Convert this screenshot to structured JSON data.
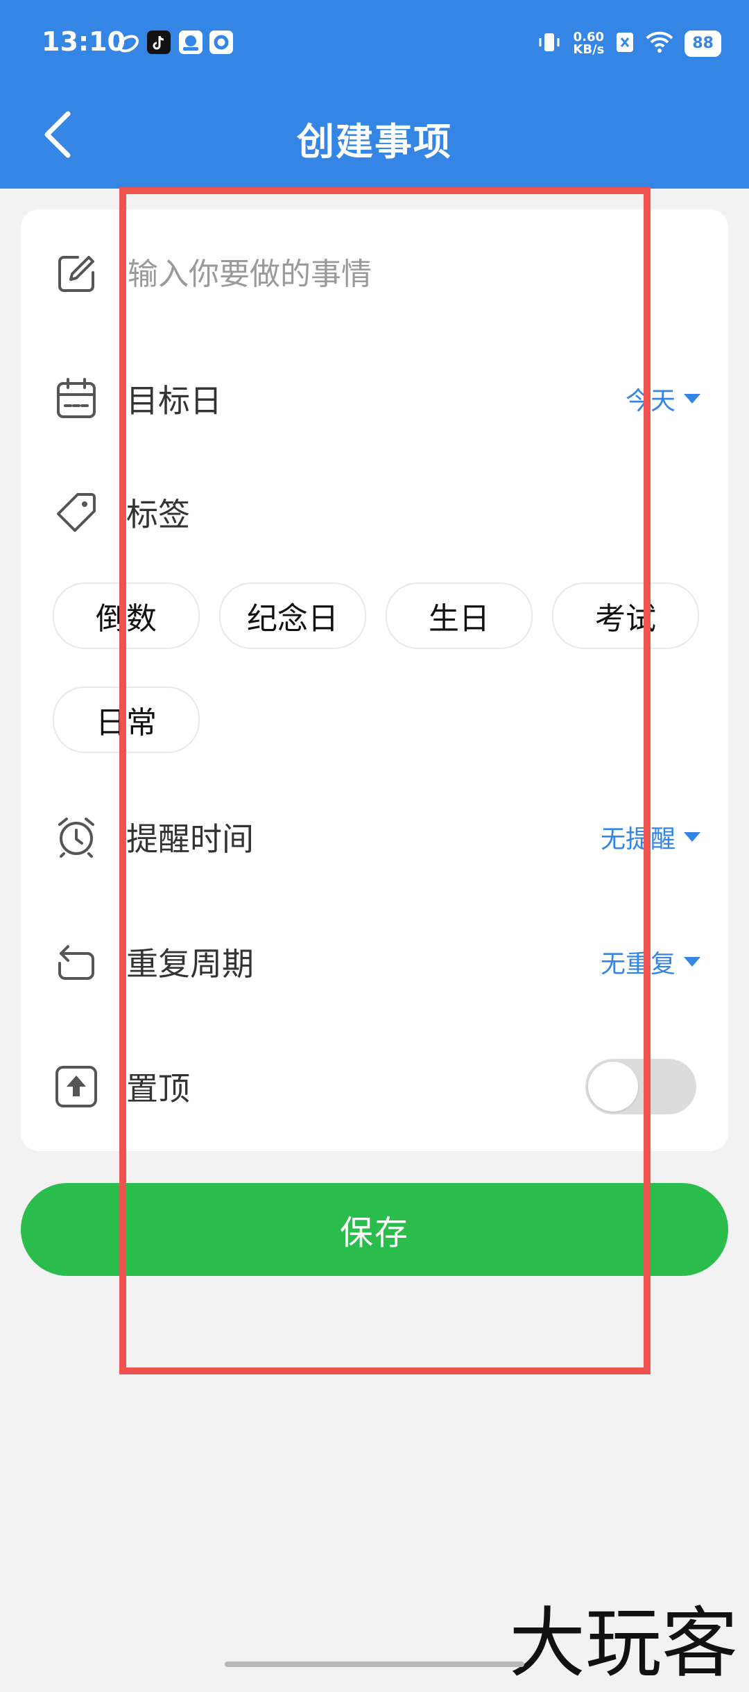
{
  "status_bar": {
    "time": "13:10",
    "net_speed_value": "0.60",
    "net_speed_unit": "KB/s",
    "battery": "88"
  },
  "nav": {
    "title": "创建事项"
  },
  "form": {
    "title_placeholder": "输入你要做的事情",
    "target_date_label": "目标日",
    "target_date_value": "今天",
    "tags_label": "标签",
    "tags": [
      "倒数",
      "纪念日",
      "生日",
      "考试",
      "日常"
    ],
    "reminder_label": "提醒时间",
    "reminder_value": "无提醒",
    "repeat_label": "重复周期",
    "repeat_value": "无重复",
    "pin_label": "置顶",
    "pin_enabled": false
  },
  "save_label": "保存",
  "watermark": "大玩客",
  "colors": {
    "header": "#3585e5",
    "save": "#2bbd4b",
    "highlight_box": "#ef5350"
  }
}
